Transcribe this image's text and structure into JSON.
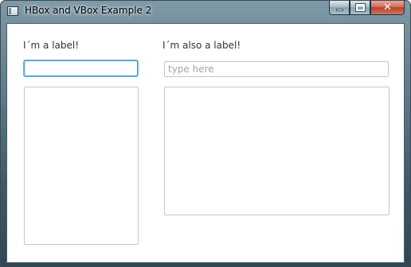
{
  "window": {
    "title": "HBox and VBox Example 2"
  },
  "left_column": {
    "label": "I´m a label!",
    "text_field_value": "",
    "text_area_value": ""
  },
  "right_column": {
    "label": "I´m also a label!",
    "text_field_value": "",
    "text_field_placeholder": "type here",
    "text_area_value": ""
  },
  "caption_buttons": {
    "minimize_icon": "minimize-icon",
    "maximize_icon": "maximize-icon",
    "close_icon": "close-icon",
    "close_glyph": "✕"
  },
  "colors": {
    "focus_accent": "#3a9ad9",
    "close_button": "#c4533b",
    "placeholder_text": "#a5a5a5"
  }
}
